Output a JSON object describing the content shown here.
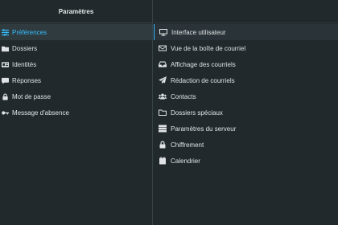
{
  "header": {
    "title": "Paramètres"
  },
  "sidebar": {
    "items": [
      {
        "label": "Préférences",
        "icon": "sliders-icon",
        "selected": true
      },
      {
        "label": "Dossiers",
        "icon": "folder-icon"
      },
      {
        "label": "Identités",
        "icon": "id-card-icon"
      },
      {
        "label": "Réponses",
        "icon": "comment-icon"
      },
      {
        "label": "Mot de passe",
        "icon": "lock-icon"
      },
      {
        "label": "Message d'absence",
        "icon": "key-icon"
      }
    ]
  },
  "sections": {
    "items": [
      {
        "label": "Interface utilisateur",
        "icon": "monitor-icon",
        "active": true
      },
      {
        "label": "Vue de la boîte de courriel",
        "icon": "envelope-icon"
      },
      {
        "label": "Affichage des courriels",
        "icon": "inbox-icon"
      },
      {
        "label": "Rédaction de courriels",
        "icon": "paper-plane-icon"
      },
      {
        "label": "Contacts",
        "icon": "users-icon"
      },
      {
        "label": "Dossiers spéciaux",
        "icon": "folder-outline-icon"
      },
      {
        "label": "Paramètres du serveur",
        "icon": "server-icon"
      },
      {
        "label": "Chiffrement",
        "icon": "lock-icon"
      },
      {
        "label": "Calendrier",
        "icon": "calendar-icon"
      }
    ]
  },
  "colors": {
    "background": "#21292c",
    "accent": "#37beff",
    "selected_bg": "#2f3b3f",
    "text": "#dfe3e5",
    "divider": "#374246"
  }
}
